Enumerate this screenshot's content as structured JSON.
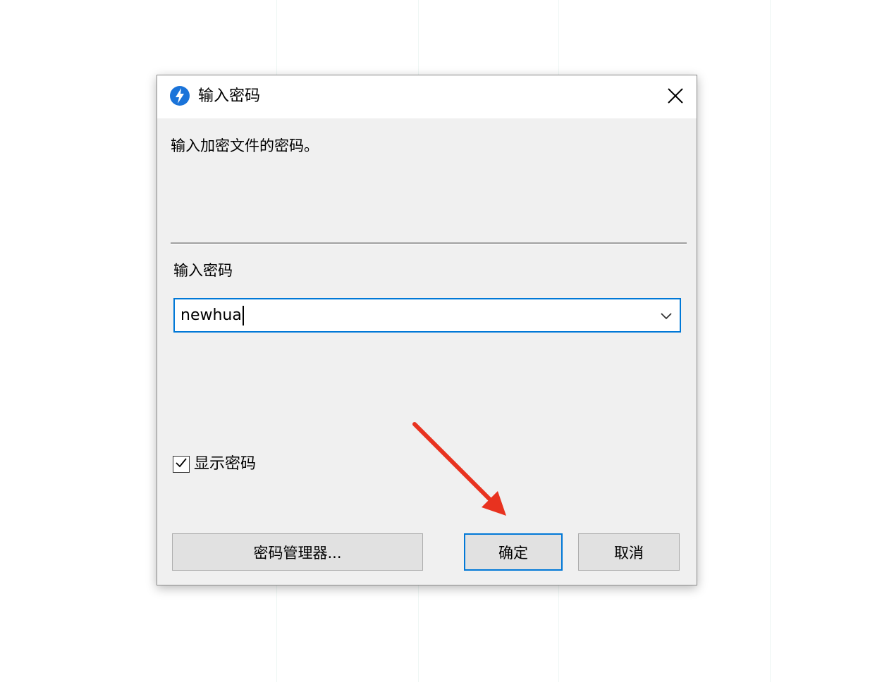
{
  "dialog": {
    "title": "输入密码",
    "description": "输入加密文件的密码。",
    "field_label": "输入密码",
    "password_value": "newhua",
    "show_password_label": "显示密码",
    "show_password_checked": true,
    "buttons": {
      "manager": "密码管理器...",
      "ok": "确定",
      "cancel": "取消"
    }
  },
  "icons": {
    "app": "lightning-badge-icon",
    "close": "close-icon",
    "dropdown": "chevron-down-icon",
    "check": "checkmark-icon",
    "annotation": "red-arrow-icon"
  },
  "colors": {
    "accent": "#0078d7",
    "annotation": "#e8321f"
  }
}
